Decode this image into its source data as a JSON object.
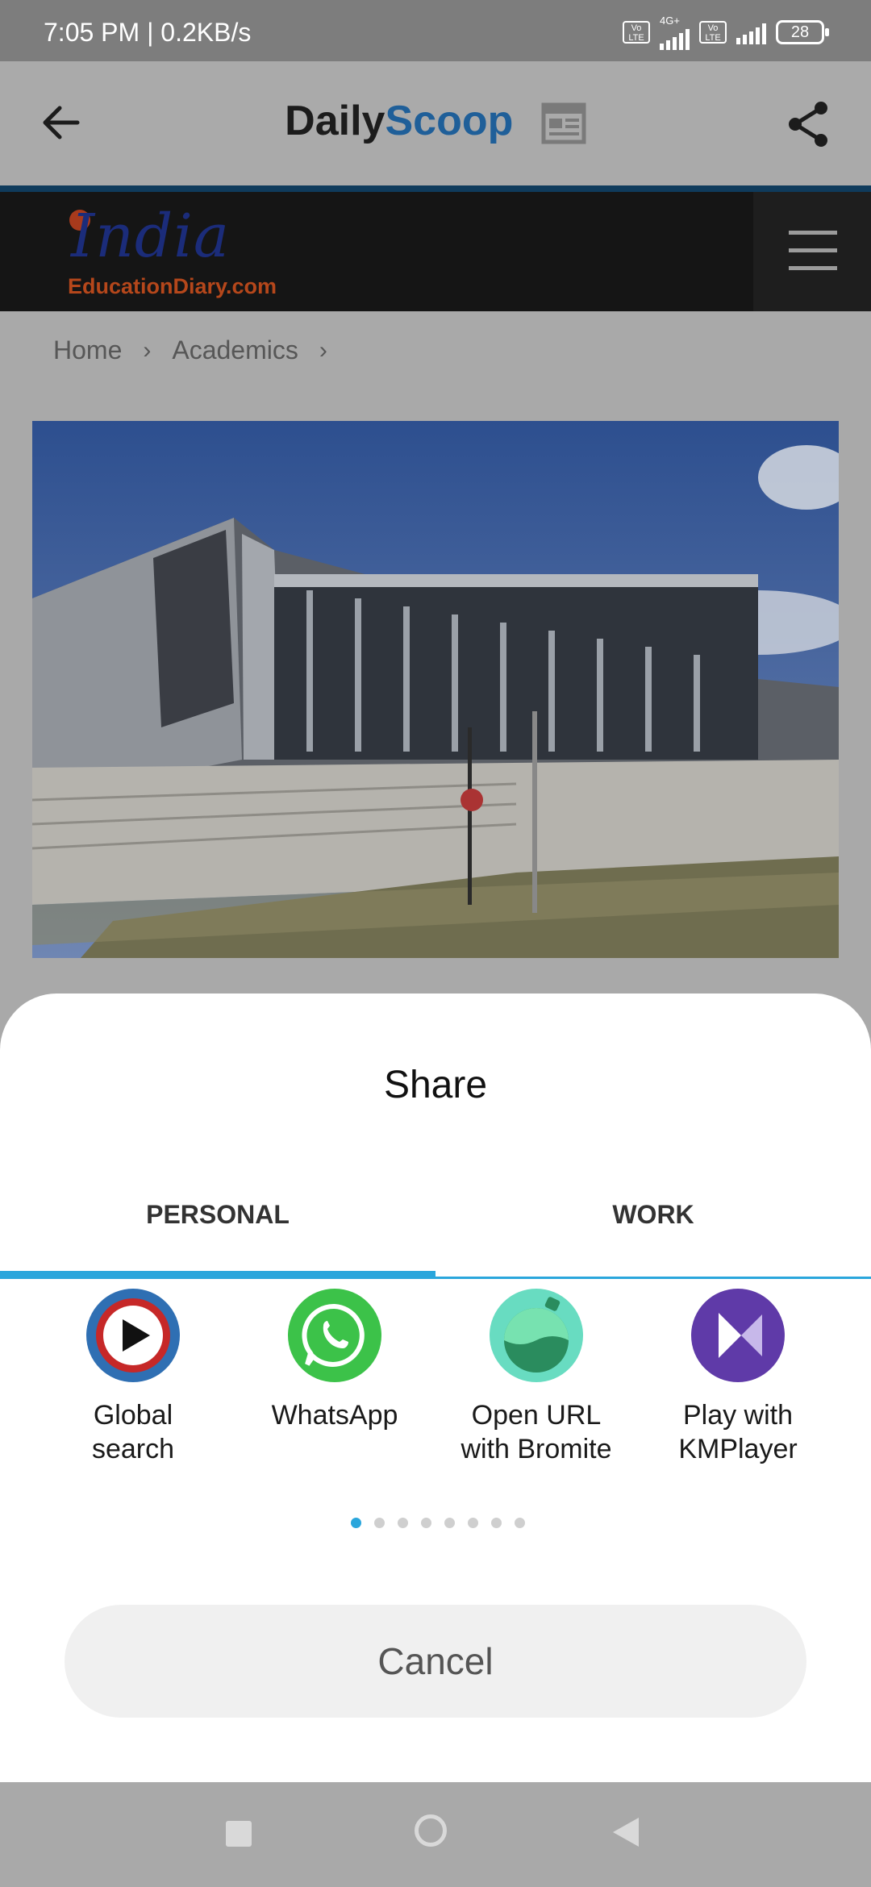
{
  "status_bar": {
    "time_speed": "7:05 PM | 0.2KB/s",
    "volte_1": "Vo LTE",
    "network_type": "4G+",
    "volte_2": "Vo LTE",
    "battery": "28"
  },
  "app_bar": {
    "title_part1": "Daily",
    "title_part2": "Scoop",
    "title_color_dark": "#1c1c1c",
    "title_color_blue": "#1f5f99"
  },
  "website": {
    "logo_top": "India",
    "logo_bottom": "EducationDiary.com",
    "breadcrumb": [
      "Home",
      "Academics"
    ]
  },
  "share_sheet": {
    "title": "Share",
    "tabs": [
      {
        "label": "PERSONAL",
        "selected": true
      },
      {
        "label": "WORK",
        "selected": false
      }
    ],
    "apps": [
      {
        "label": "Global search",
        "icon": "global-search-icon"
      },
      {
        "label": "WhatsApp",
        "icon": "whatsapp-icon"
      },
      {
        "label": "Open URL with Bromite",
        "icon": "bromite-icon"
      },
      {
        "label": "Play with KMPlayer",
        "icon": "kmplayer-icon"
      }
    ],
    "page_count": 8,
    "current_page": 1,
    "cancel_label": "Cancel",
    "accent_color": "#2aa6dc"
  }
}
